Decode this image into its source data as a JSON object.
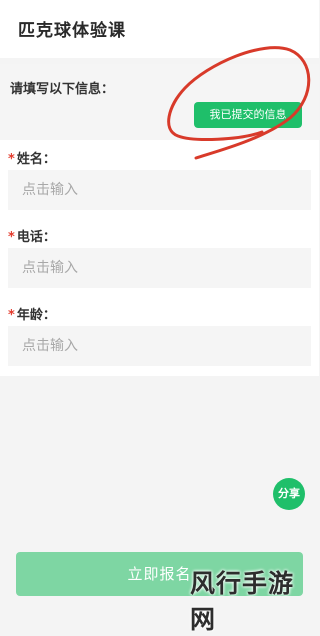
{
  "page": {
    "title": "匹克球体验课"
  },
  "info": {
    "label": "请填写以下信息：",
    "submitted_button": "我已提交的信息"
  },
  "form": {
    "required_mark": "*",
    "fields": [
      {
        "label": "姓名：",
        "placeholder": "点击输入",
        "value": ""
      },
      {
        "label": "电话：",
        "placeholder": "点击输入",
        "value": ""
      },
      {
        "label": "年龄：",
        "placeholder": "点击输入",
        "value": ""
      }
    ]
  },
  "actions": {
    "share_label": "分享",
    "register_label": "立即报名"
  },
  "watermark": {
    "text": "风行手游网"
  },
  "colors": {
    "accent_green": "#1fbf6a",
    "register_disabled_green": "#7ed6a3",
    "required_red": "#e33b2d",
    "annotation_red": "#d83a2a"
  }
}
